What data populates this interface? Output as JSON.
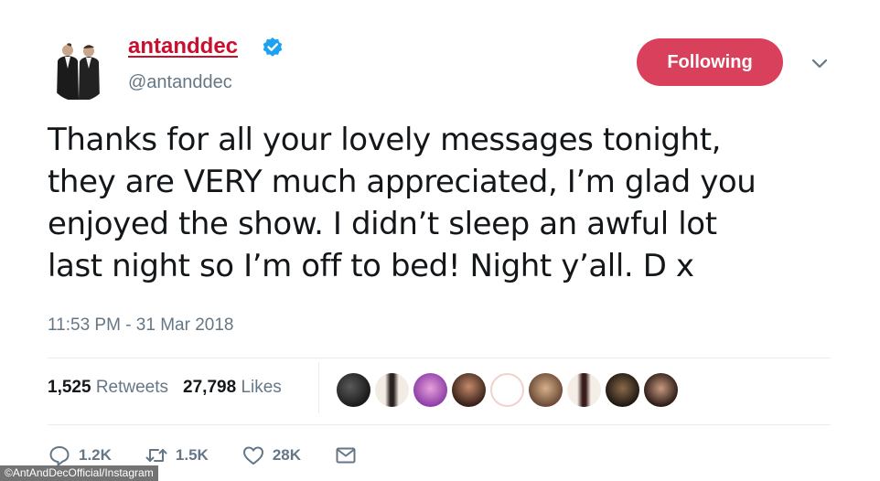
{
  "header": {
    "display_name": "antanddec",
    "handle": "@antanddec",
    "follow_label": "Following"
  },
  "tweet": {
    "lines": [
      "Thanks for all your lovely messages tonight,",
      "they are VERY much appreciated, I’m glad you",
      "enjoyed the show. I didn’t sleep an awful lot",
      "last night so I’m off to bed! Night y’all. D x"
    ],
    "timestamp": "11:53 PM - 31 Mar 2018"
  },
  "stats": {
    "retweets_count": "1,525",
    "retweets_label": "Retweets",
    "likes_count": "27,798",
    "likes_label": "Likes"
  },
  "actions": {
    "reply_count": "1.2K",
    "retweet_count": "1.5K",
    "like_count": "28K"
  },
  "icons": {
    "verified": "verified-badge-icon",
    "chevron": "chevron-down-icon",
    "reply": "reply-icon",
    "retweet": "retweet-icon",
    "like": "heart-icon",
    "message": "envelope-icon"
  },
  "colors": {
    "name": "#c8102e",
    "follow_button": "#d9405b",
    "verified": "#1da1f2",
    "secondary_text": "#657786"
  },
  "watermark": "©AntAndDecOfficial/Instagram"
}
